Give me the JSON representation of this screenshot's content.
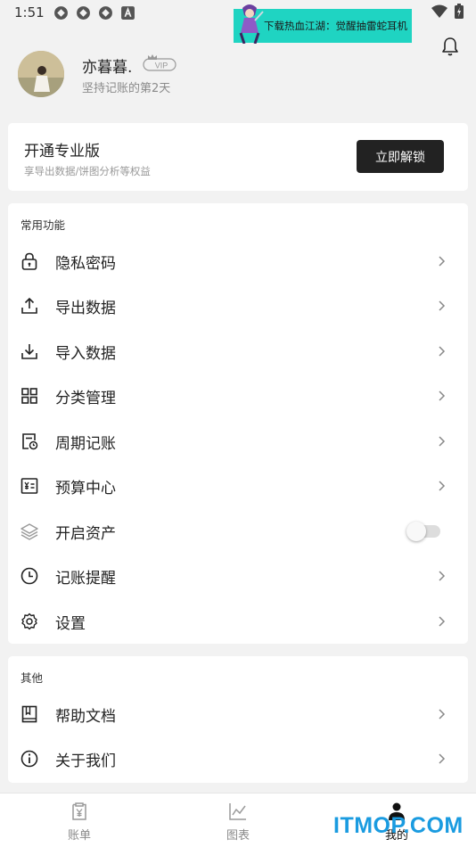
{
  "status_bar": {
    "time": "1:51"
  },
  "ad": {
    "text": "下载热血江湖：觉醒抽雷蛇耳机"
  },
  "profile": {
    "username": "亦暮暮.",
    "vip_label": "VIP",
    "subtitle": "坚持记账的第2天"
  },
  "pro": {
    "title": "开通专业版",
    "subtitle": "享导出数据/饼图分析等权益",
    "button": "立即解锁"
  },
  "common": {
    "title": "常用功能",
    "items": [
      {
        "label": "隐私密码",
        "icon": "lock-icon"
      },
      {
        "label": "导出数据",
        "icon": "upload-icon"
      },
      {
        "label": "导入数据",
        "icon": "download-icon"
      },
      {
        "label": "分类管理",
        "icon": "grid-icon"
      },
      {
        "label": "周期记账",
        "icon": "calendar-clock-icon"
      },
      {
        "label": "预算中心",
        "icon": "budget-icon"
      },
      {
        "label": "开启资产",
        "icon": "layers-icon",
        "toggle": false
      },
      {
        "label": "记账提醒",
        "icon": "clock-icon"
      },
      {
        "label": "设置",
        "icon": "gear-icon"
      }
    ]
  },
  "other": {
    "title": "其他",
    "items": [
      {
        "label": "帮助文档",
        "icon": "book-icon"
      },
      {
        "label": "关于我们",
        "icon": "info-icon"
      }
    ]
  },
  "tabs": [
    {
      "label": "账单",
      "icon": "bill-icon",
      "active": false
    },
    {
      "label": "图表",
      "icon": "chart-icon",
      "active": false
    },
    {
      "label": "我的",
      "icon": "person-icon",
      "active": true
    }
  ],
  "watermark": {
    "text": "ITMOP.COM"
  }
}
